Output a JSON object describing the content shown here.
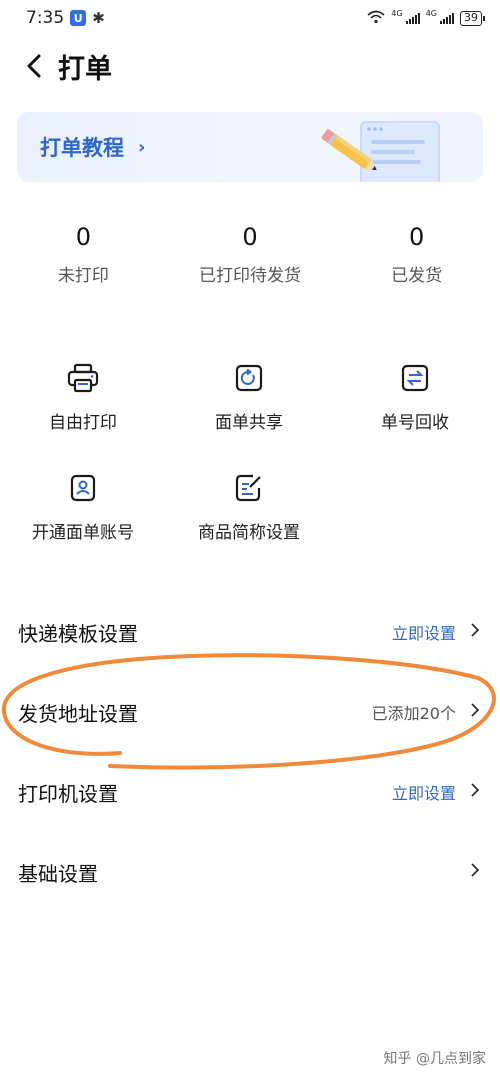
{
  "status_bar": {
    "time": "7:35",
    "app_badge": "U",
    "bluetooth_glyph": "✱",
    "signal_1_label": "4G",
    "signal_2_label": "4G",
    "battery": "39"
  },
  "header": {
    "title": "打单"
  },
  "banner": {
    "label": "打单教程"
  },
  "stats": [
    {
      "count": "0",
      "label": "未打印"
    },
    {
      "count": "0",
      "label": "已打印待发货"
    },
    {
      "count": "0",
      "label": "已发货"
    }
  ],
  "tools": [
    {
      "label": "自由打印",
      "icon": "printer-icon"
    },
    {
      "label": "面单共享",
      "icon": "share-icon"
    },
    {
      "label": "单号回收",
      "icon": "recycle-icon"
    },
    {
      "label": "开通面单账号",
      "icon": "account-icon"
    },
    {
      "label": "商品简称设置",
      "icon": "edit-icon"
    }
  ],
  "settings": [
    {
      "title": "快递模板设置",
      "value": "立即设置",
      "value_style": "blue"
    },
    {
      "title": "发货地址设置",
      "value": "已添加20个",
      "value_style": "gray"
    },
    {
      "title": "打印机设置",
      "value": "立即设置",
      "value_style": "blue"
    },
    {
      "title": "基础设置",
      "value": "",
      "value_style": "gray"
    }
  ],
  "watermark": "知乎 @几点到家",
  "colors": {
    "accent": "#2f66c7",
    "banner_bg": "#e9f1fd",
    "annotation": "#f08a3a"
  }
}
